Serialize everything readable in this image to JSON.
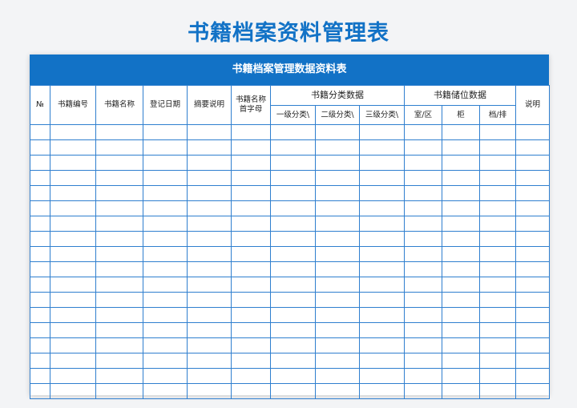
{
  "title": "书籍档案资料管理表",
  "banner": "书籍档案管理数据资料表",
  "headers": {
    "no": "№",
    "book_code": "书籍编号",
    "book_name": "书籍名称",
    "register_date": "登记日期",
    "summary": "摘要说明",
    "initials_line1": "书籍名称",
    "initials_line2": "首字母",
    "category_group": "书籍分类数据",
    "category_1": "一级分类\\",
    "category_2": "二级分类\\",
    "category_3": "三级分类\\",
    "storage_group": "书籍储位数据",
    "room": "室/区",
    "cabinet": "柜",
    "shelf": "档/排",
    "remark": "说明"
  },
  "rows": [
    [
      "",
      "",
      "",
      "",
      "",
      "",
      "",
      "",
      "",
      "",
      "",
      "",
      ""
    ],
    [
      "",
      "",
      "",
      "",
      "",
      "",
      "",
      "",
      "",
      "",
      "",
      "",
      ""
    ],
    [
      "",
      "",
      "",
      "",
      "",
      "",
      "",
      "",
      "",
      "",
      "",
      "",
      ""
    ],
    [
      "",
      "",
      "",
      "",
      "",
      "",
      "",
      "",
      "",
      "",
      "",
      "",
      ""
    ],
    [
      "",
      "",
      "",
      "",
      "",
      "",
      "",
      "",
      "",
      "",
      "",
      "",
      ""
    ],
    [
      "",
      "",
      "",
      "",
      "",
      "",
      "",
      "",
      "",
      "",
      "",
      "",
      ""
    ],
    [
      "",
      "",
      "",
      "",
      "",
      "",
      "",
      "",
      "",
      "",
      "",
      "",
      ""
    ],
    [
      "",
      "",
      "",
      "",
      "",
      "",
      "",
      "",
      "",
      "",
      "",
      "",
      ""
    ],
    [
      "",
      "",
      "",
      "",
      "",
      "",
      "",
      "",
      "",
      "",
      "",
      "",
      ""
    ],
    [
      "",
      "",
      "",
      "",
      "",
      "",
      "",
      "",
      "",
      "",
      "",
      "",
      ""
    ],
    [
      "",
      "",
      "",
      "",
      "",
      "",
      "",
      "",
      "",
      "",
      "",
      "",
      ""
    ],
    [
      "",
      "",
      "",
      "",
      "",
      "",
      "",
      "",
      "",
      "",
      "",
      "",
      ""
    ],
    [
      "",
      "",
      "",
      "",
      "",
      "",
      "",
      "",
      "",
      "",
      "",
      "",
      ""
    ],
    [
      "",
      "",
      "",
      "",
      "",
      "",
      "",
      "",
      "",
      "",
      "",
      "",
      ""
    ],
    [
      "",
      "",
      "",
      "",
      "",
      "",
      "",
      "",
      "",
      "",
      "",
      "",
      ""
    ],
    [
      "",
      "",
      "",
      "",
      "",
      "",
      "",
      "",
      "",
      "",
      "",
      "",
      ""
    ],
    [
      "",
      "",
      "",
      "",
      "",
      "",
      "",
      "",
      "",
      "",
      "",
      "",
      ""
    ],
    [
      "",
      "",
      "",
      "",
      "",
      "",
      "",
      "",
      "",
      "",
      "",
      "",
      ""
    ]
  ],
  "colors": {
    "accent": "#1272c6",
    "grid": "#2f7fcf",
    "background": "#f3f4f6"
  }
}
